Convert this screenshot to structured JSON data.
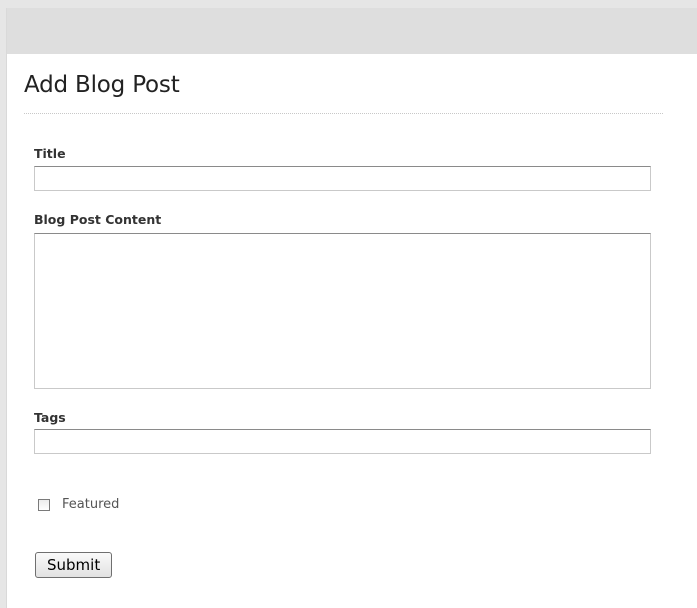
{
  "form": {
    "title": "Add Blog Post",
    "fields": {
      "title_label": "Title",
      "title_value": "",
      "content_label": "Blog Post Content",
      "content_value": "",
      "tags_label": "Tags",
      "tags_value": ""
    },
    "featured": {
      "label": "Featured",
      "checked": false
    },
    "submit_label": "Submit"
  },
  "colors": {
    "header_bar": "#dedede",
    "background": "#e6e6e6",
    "panel": "#ffffff"
  }
}
